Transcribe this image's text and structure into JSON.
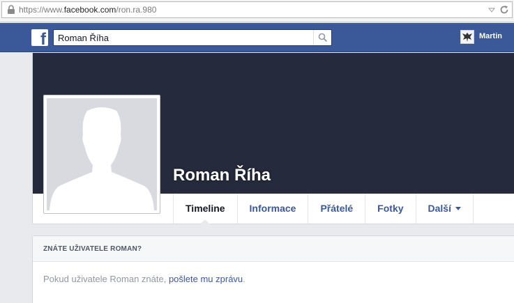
{
  "browser": {
    "url_prefix": "https://www.",
    "url_domain": "facebook.com",
    "url_path": "/ron.ra.980"
  },
  "topbar": {
    "logo": "f",
    "search_value": "Roman Říha",
    "search_icon": "search-icon",
    "user_name": "Martin"
  },
  "profile": {
    "name": "Roman Říha",
    "tabs": [
      {
        "label": "Timeline"
      },
      {
        "label": "Informace"
      },
      {
        "label": "Přátelé"
      },
      {
        "label": "Fotky"
      },
      {
        "label": "Další"
      }
    ]
  },
  "infobox": {
    "heading": "ZNÁTE UŽIVATELE ROMAN?",
    "text_before": "Pokud uživatele Roman znáte, ",
    "link": "pošlete mu zprávu",
    "text_after": "."
  },
  "colors": {
    "fb_blue": "#3b5998",
    "cover": "#252a3c",
    "page_bg": "#e9eaed"
  }
}
